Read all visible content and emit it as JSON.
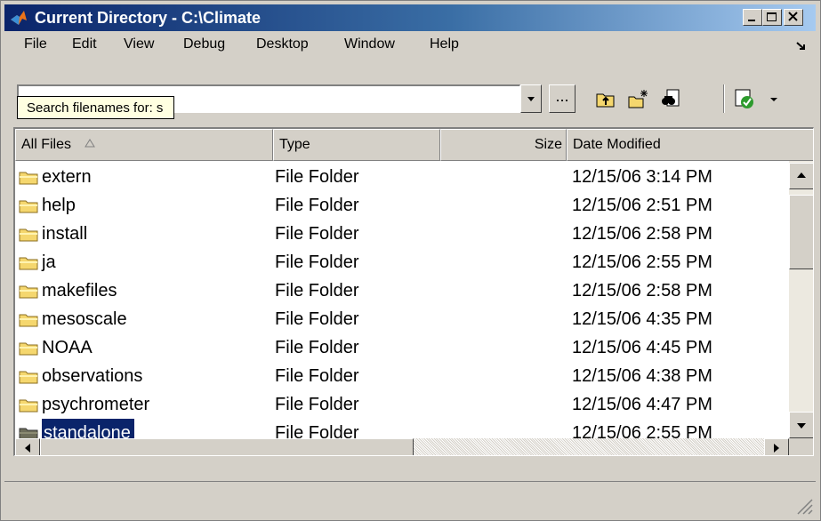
{
  "window": {
    "title": "Current Directory - C:\\Climate"
  },
  "menu": [
    "File",
    "Edit",
    "View",
    "Debug",
    "Desktop",
    "Window",
    "Help"
  ],
  "toolbar": {
    "browse_label": "...",
    "tooltip": "Search filenames for: s"
  },
  "columns": {
    "name": "All Files",
    "type": "Type",
    "size": "Size",
    "date": "Date Modified"
  },
  "files": [
    {
      "name": "extern",
      "type": "File Folder",
      "date": "12/15/06 3:14 PM"
    },
    {
      "name": "help",
      "type": "File Folder",
      "date": "12/15/06 2:51 PM"
    },
    {
      "name": "install",
      "type": "File Folder",
      "date": "12/15/06 2:58 PM"
    },
    {
      "name": "ja",
      "type": "File Folder",
      "date": "12/15/06 2:55 PM"
    },
    {
      "name": "makefiles",
      "type": "File Folder",
      "date": "12/15/06 2:58 PM"
    },
    {
      "name": "mesoscale",
      "type": "File Folder",
      "date": "12/15/06 4:35 PM"
    },
    {
      "name": "NOAA",
      "type": "File Folder",
      "date": "12/15/06 4:45 PM"
    },
    {
      "name": "observations",
      "type": "File Folder",
      "date": "12/15/06 4:38 PM"
    },
    {
      "name": "psychrometer",
      "type": "File Folder",
      "date": "12/15/06 4:47 PM"
    },
    {
      "name": "standalone",
      "type": "File Folder",
      "date": "12/15/06 2:55 PM"
    }
  ],
  "selected_index": 9,
  "colors": {
    "title_start": "#0a246a",
    "title_end": "#a6caf0",
    "folder": "#f5d76e",
    "selection": "#0a246a"
  }
}
